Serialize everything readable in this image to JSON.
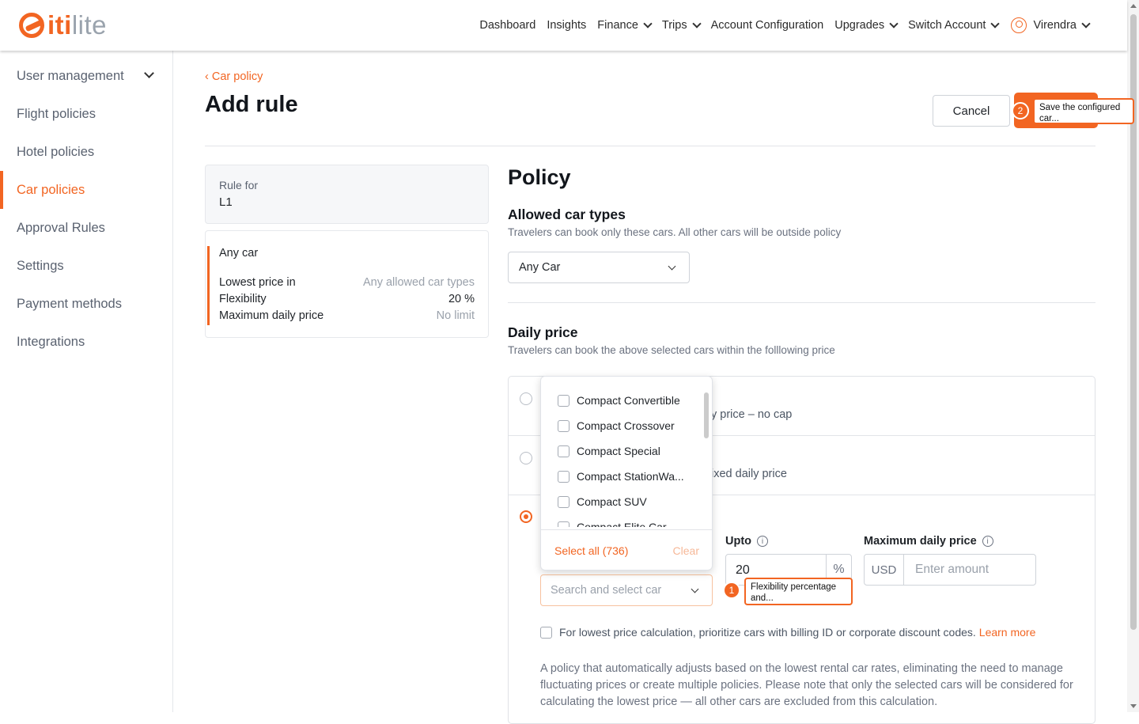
{
  "brand": {
    "logo_primary": "iti",
    "logo_secondary": "lite",
    "accent_color": "#f26522"
  },
  "nav": {
    "items": [
      {
        "label": "Dashboard",
        "dropdown": false
      },
      {
        "label": "Insights",
        "dropdown": false
      },
      {
        "label": "Finance",
        "dropdown": true
      },
      {
        "label": "Trips",
        "dropdown": true
      },
      {
        "label": "Account Configuration",
        "dropdown": false
      },
      {
        "label": "Upgrades",
        "dropdown": true
      },
      {
        "label": "Switch Account",
        "dropdown": true
      }
    ],
    "user_name": "Virendra"
  },
  "sidebar": {
    "items": [
      {
        "label": "User management"
      },
      {
        "label": "Flight policies"
      },
      {
        "label": "Hotel policies"
      },
      {
        "label": "Car policies",
        "active": true
      },
      {
        "label": "Approval Rules"
      },
      {
        "label": "Settings"
      },
      {
        "label": "Payment methods"
      },
      {
        "label": "Integrations"
      }
    ]
  },
  "header": {
    "back_label": "Car policy",
    "title": "Add rule",
    "cancel_label": "Cancel"
  },
  "callouts": {
    "save": {
      "badge": "2",
      "text": "Save the configured car..."
    },
    "flex": {
      "badge": "1",
      "text": "Flexibility percentage and..."
    }
  },
  "summary": {
    "rule_for_label": "Rule for",
    "rule_for_value": "L1",
    "card_title": "Any car",
    "rows": [
      {
        "key": "Lowest price in",
        "value": "Any allowed car types"
      },
      {
        "key": "Flexibility",
        "value": "20 %"
      },
      {
        "key": "Maximum daily price",
        "value": "No limit"
      }
    ]
  },
  "policy": {
    "heading": "Policy",
    "car_types": {
      "title": "Allowed car types",
      "subtitle": "Travelers can book only these cars. All other cars will be outside policy",
      "selected": "Any Car"
    },
    "daily_price": {
      "title": "Daily price",
      "subtitle": "Travelers can book the above selected cars within the folllowing price",
      "option1_text": "y price – no cap",
      "option2_text": "ixed daily price"
    },
    "dropdown": {
      "items": [
        "Compact Convertible",
        "Compact Crossover",
        "Compact Special",
        "Compact StationWa...",
        "Compact SUV",
        "Compact Elite Car"
      ],
      "select_all_label": "Select all (736)",
      "clear_label": "Clear"
    },
    "search_placeholder": "Search and select car",
    "upto_label": "Upto",
    "flexibility_value": "20",
    "flexibility_unit": "%",
    "max_price_label": "Maximum daily price",
    "currency": "USD",
    "amount_placeholder": "Enter amount",
    "billing_checkbox_text": "For lowest price calculation, prioritize cars with billing ID or corporate discount codes.",
    "learn_more": "Learn more",
    "description": "A policy that automatically adjusts based on the lowest rental car rates, eliminating the need to manage fluctuating prices or create multiple policies. Please note that only the selected cars will be considered for calculating the lowest price — all other cars are excluded from this calculation."
  }
}
